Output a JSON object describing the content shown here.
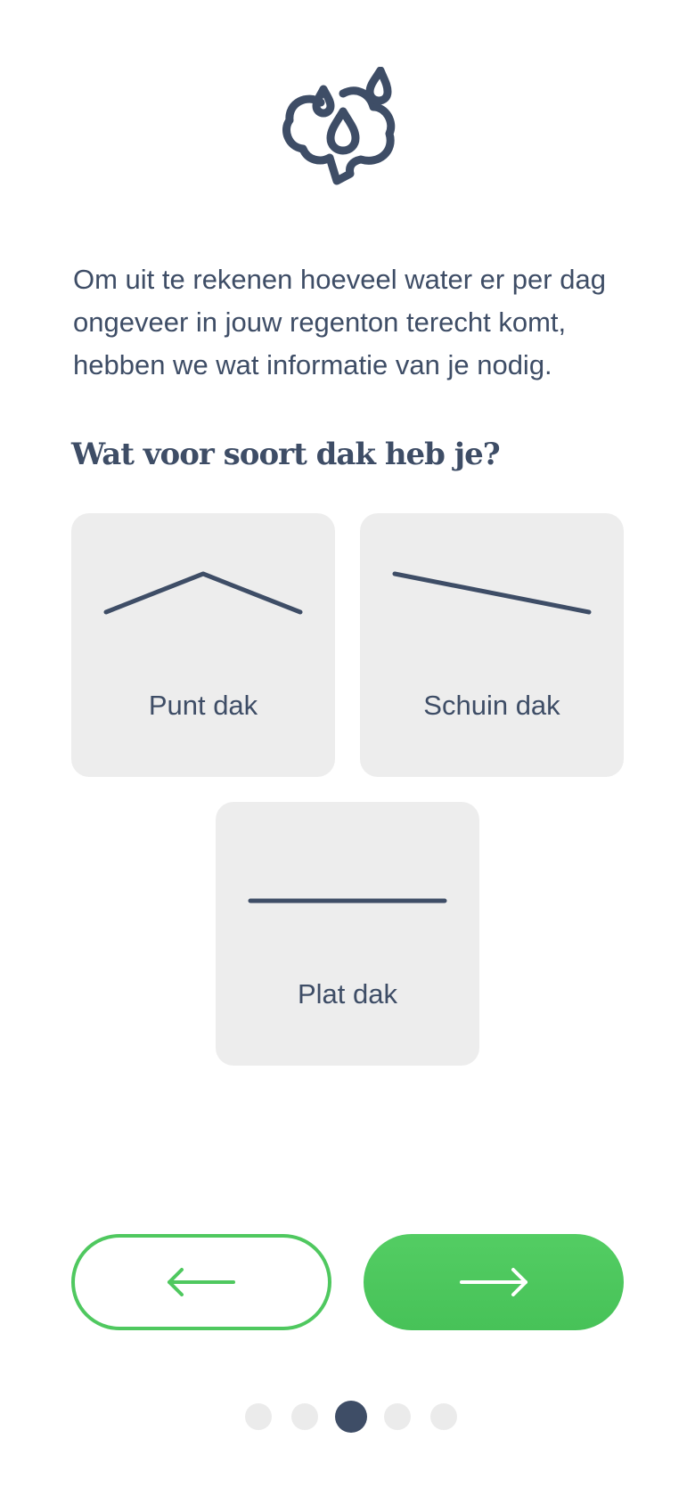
{
  "header": {
    "icon": "brain-water-drops-icon"
  },
  "intro_text": "Om uit te rekenen hoeveel water er per dag ongeveer in jouw regenton terecht komt, hebben we wat informatie van je nodig.",
  "question": "Wat voor soort dak heb je?",
  "roof_options": [
    {
      "label": "Punt dak",
      "icon": "pitched-roof-icon"
    },
    {
      "label": "Schuin dak",
      "icon": "slanted-roof-icon"
    },
    {
      "label": "Plat dak",
      "icon": "flat-roof-icon"
    }
  ],
  "navigation": {
    "back_icon": "arrow-left-icon",
    "next_icon": "arrow-right-icon"
  },
  "pagination": {
    "total": 5,
    "current": 3
  },
  "colors": {
    "text": "#3e4d66",
    "accent_green": "#4fc85f",
    "card_background": "#ededed",
    "dot_inactive": "#ebebeb"
  }
}
